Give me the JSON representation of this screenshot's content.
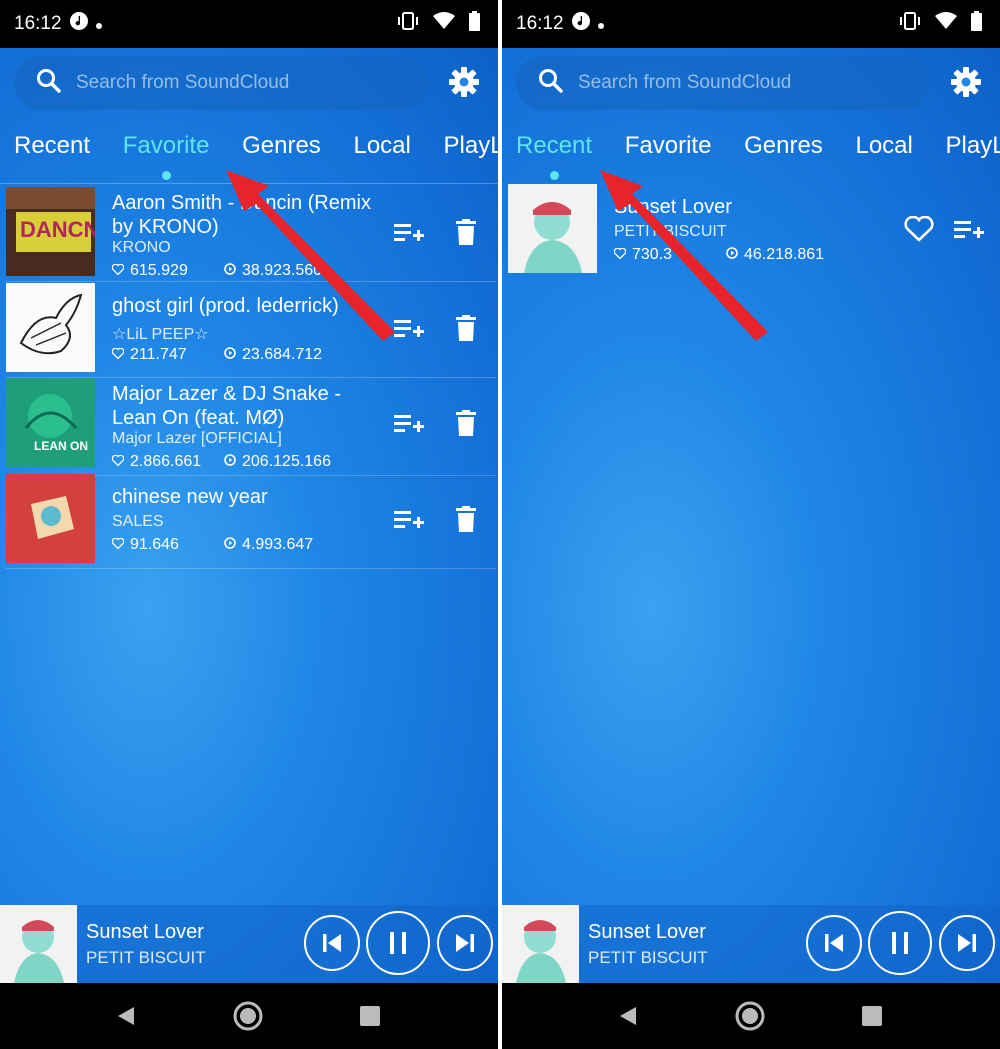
{
  "status": {
    "time": "16:12"
  },
  "search": {
    "placeholder": "Search from SoundCloud"
  },
  "tabs": [
    {
      "label": "Recent"
    },
    {
      "label": "Favorite"
    },
    {
      "label": "Genres"
    },
    {
      "label": "Local"
    },
    {
      "label": "PlayLi"
    }
  ],
  "left_screen": {
    "active_tab": "Favorite",
    "tracks": [
      {
        "title": "Aaron Smith - Dancin (Remix by KRONO)",
        "artist": "KRONO",
        "likes": "615.929",
        "plays": "38.923.560"
      },
      {
        "title": "ghost girl (prod. lederrick)",
        "artist": "☆LiL PEEP☆",
        "likes": "211.747",
        "plays": "23.684.712"
      },
      {
        "title": "Major Lazer & DJ Snake - Lean On (feat. MØ)",
        "artist": "Major Lazer [OFFICIAL]",
        "likes": "2.866.661",
        "plays": "206.125.166"
      },
      {
        "title": "chinese new year",
        "artist": "SALES",
        "likes": "91.646",
        "plays": "4.993.647"
      }
    ]
  },
  "right_screen": {
    "active_tab": "Recent",
    "tracks": [
      {
        "title": "Sunset Lover",
        "artist": "PETIT BISCUIT",
        "likes": "730.3",
        "plays": "46.218.861"
      }
    ]
  },
  "player": {
    "title": "Sunset Lover",
    "artist": "PETIT BISCUIT"
  },
  "colors": {
    "accent": "#5fe5f0",
    "background": "#1f86e6",
    "arrow": "#e8232a"
  }
}
